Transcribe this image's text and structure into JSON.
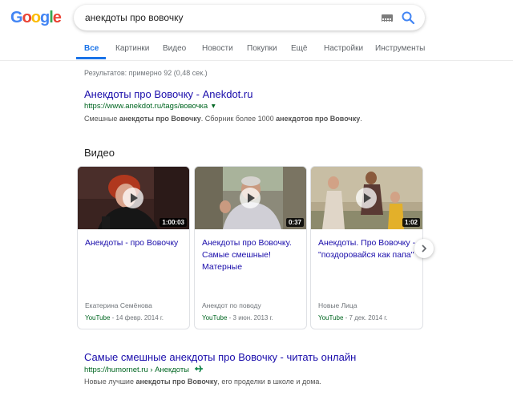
{
  "logo": {
    "letters": [
      "G",
      "o",
      "o",
      "g",
      "l",
      "e"
    ],
    "colors": [
      "#4285f4",
      "#ea4335",
      "#fbbc05",
      "#4285f4",
      "#34a853",
      "#ea4335"
    ]
  },
  "search": {
    "query": "анекдоты про вовочку",
    "kbd_icon": "keyboard-icon",
    "search_icon": "magnifier-icon",
    "accent": "#1a73e8"
  },
  "tabs": [
    {
      "label": "Все",
      "active": true
    },
    {
      "label": "Картинки",
      "active": false
    },
    {
      "label": "Видео",
      "active": false
    },
    {
      "label": "Новости",
      "active": false
    },
    {
      "label": "Покупки",
      "active": false
    },
    {
      "label": "Ещё",
      "active": false
    },
    {
      "label": "Настройки",
      "active": false
    },
    {
      "label": "Инструменты",
      "active": false
    }
  ],
  "stats": "Результатов: примерно 92 (0,48 сек.)",
  "result1": {
    "title": "Анекдоты про Вовочку - Anekdot.ru",
    "url": "https://www.anekdot.ru/tags/вовочка",
    "url_caret": "▾",
    "snippet": [
      {
        "text": "Смешные ",
        "bold": false
      },
      {
        "text": "анекдоты про Вовочку",
        "bold": true
      },
      {
        "text": ". Сборник более 1000 ",
        "bold": false
      },
      {
        "text": "анекдотов про Вовочку",
        "bold": true
      },
      {
        "text": ".",
        "bold": false
      }
    ]
  },
  "videos": {
    "heading": "Видео",
    "items": [
      {
        "duration": "1:00:03",
        "title": "Анекдоты - про Вовочку",
        "author": "Екатерина Семёнова",
        "source": "YouTube",
        "date": " - 14 февр. 2014 г."
      },
      {
        "duration": "0:37",
        "title": "Анекдоты про Вовочку. Самые смешные! Матерные",
        "author": "Анекдот по поводу",
        "source": "YouTube",
        "date": " - 3 июн. 2013 г."
      },
      {
        "duration": "1:02",
        "title": "Анекдоты. Про Вовочку - \"поздоровайся как папа\"",
        "author": "Новые Лица",
        "source": "YouTube",
        "date": " - 7 дек. 2014 г."
      }
    ],
    "next_icon": "chevron-right-icon"
  },
  "result2": {
    "title": "Самые смешные анекдоты про Вовочку - читать онлайн",
    "url": "https://humornet.ru › Анекдоты",
    "url_icon": "plane-icon",
    "snippet": [
      {
        "text": "Новые лучшие ",
        "bold": false
      },
      {
        "text": "анекдоты про Вовочку",
        "bold": true
      },
      {
        "text": ", его проделки в школе и дома.",
        "bold": false
      }
    ]
  }
}
